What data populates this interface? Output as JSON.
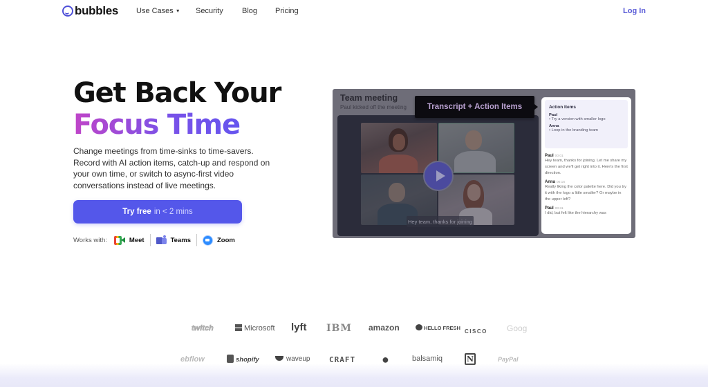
{
  "nav": {
    "brand": "bubbles",
    "links": [
      "Use Cases",
      "Security",
      "Blog",
      "Pricing"
    ],
    "login": "Log In",
    "brand_color": "#5557d6"
  },
  "hero": {
    "title_line1": "Get Back Your",
    "title_line2": "Focus Time",
    "description": "Change meetings from time-sinks to time-savers. Record with AI action items, catch-up and respond on your own time, or switch to async-first video conversations instead of live meetings.",
    "cta_main": "Try free",
    "cta_sub": "in < 2 mins",
    "cta_color": "#5457ea",
    "works_with_label": "Works with:",
    "integrations": [
      {
        "name": "Meet",
        "icon": "google-meet-icon"
      },
      {
        "name": "Teams",
        "icon": "microsoft-teams-icon"
      },
      {
        "name": "Zoom",
        "icon": "zoom-icon"
      }
    ]
  },
  "demo": {
    "title": "Team meeting",
    "subtitle": "Paul kicked off the meeting",
    "badge": "Transcript + Action Items",
    "caption": "Hey team, thanks for joining",
    "action_items": {
      "title": "Action Items",
      "groups": [
        {
          "name": "Paul",
          "item": "• Try a version with smaller logo"
        },
        {
          "name": "Anna",
          "item": "• Loop in the branding team"
        }
      ]
    },
    "transcript": [
      {
        "speaker": "Paul",
        "time": "00:01",
        "text": "Hey team, thanks for joining. Let me share my screen and we'll get right into it. Here's the first direction."
      },
      {
        "speaker": "Anna",
        "time": "00:16",
        "text": "Really liking the color palette here. Did you try it with the logo a little smaller? Or maybe in the upper left?"
      },
      {
        "speaker": "Paul",
        "time": "00:31",
        "text": "I did, but felt like the hierarchy was"
      }
    ]
  },
  "logos": {
    "row1": [
      "twitch",
      "Microsoft",
      "lyft",
      "IBM",
      "amazon",
      "HELLO FRESH",
      "CISCO",
      "Goog"
    ],
    "row2": [
      "ebflow",
      "shopify",
      "waveup",
      "CRAFT",
      "apple",
      "balsamiq",
      "N",
      "PayPal"
    ]
  }
}
